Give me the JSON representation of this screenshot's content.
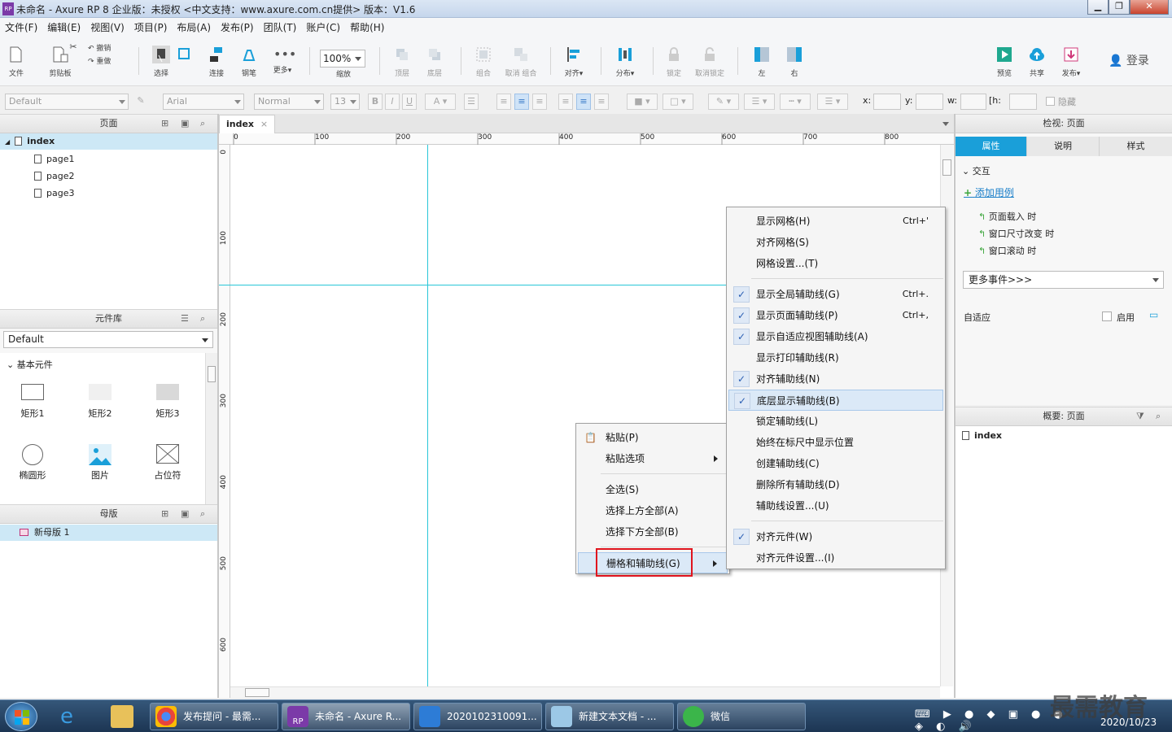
{
  "window": {
    "title": "未命名 - Axure RP 8 企业版：未授权      <中文支持：www.axure.com.cn提供> 版本：V1.6",
    "logo": "RP",
    "controls": [
      "minimize",
      "maximize",
      "close"
    ]
  },
  "menubar": [
    "文件(F)",
    "编辑(E)",
    "视图(V)",
    "项目(P)",
    "布局(A)",
    "发布(P)",
    "团队(T)",
    "账户(C)",
    "帮助(H)"
  ],
  "toolbar": {
    "file": "文件",
    "clipboard": "剪贴板",
    "cut": "",
    "undo": "撤销",
    "redo": "重做",
    "select": "选择",
    "connect": "连接",
    "pen": "钢笔",
    "more": "更多▾",
    "zoom_value": "100%",
    "zoom_label": "缩放",
    "top": "顶层",
    "bottom": "底层",
    "group": "组合",
    "ungroup": "取消 组合",
    "align": "对齐▾",
    "distribute": "分布▾",
    "lock": "锁定",
    "unlock": "取消锁定",
    "left": "左",
    "right": "右",
    "preview": "预览",
    "share": "共享",
    "publish": "发布▾",
    "login": "登录"
  },
  "formatbar": {
    "style": "Default",
    "font": "Arial",
    "weight": "Normal",
    "size": "13",
    "x_label": "x:",
    "y_label": "y:",
    "w_label": "w:",
    "h_label": "h:",
    "hide_label": "隐藏"
  },
  "pages_panel": {
    "title": "页面",
    "root": "index",
    "children": [
      "page1",
      "page2",
      "page3"
    ]
  },
  "library_panel": {
    "title": "元件库",
    "selected_library": "Default",
    "group": "基本元件",
    "widgets": [
      "矩形1",
      "矩形2",
      "矩形3",
      "椭圆形",
      "图片",
      "占位符"
    ]
  },
  "masters_panel": {
    "title": "母版",
    "items": [
      "新母版 1"
    ]
  },
  "canvas": {
    "tab": "index",
    "tab_close": "×",
    "ruler_h": [
      "0",
      "100",
      "200",
      "300",
      "400",
      "500",
      "600",
      "700",
      "800"
    ],
    "ruler_v": [
      "0",
      "100",
      "200",
      "300",
      "400",
      "500",
      "600"
    ]
  },
  "context_menu": {
    "items": [
      {
        "label": "粘贴(P)"
      },
      {
        "label": "粘贴选项",
        "submenu": true
      },
      {
        "label": "全选(S)"
      },
      {
        "label": "选择上方全部(A)"
      },
      {
        "label": "选择下方全部(B)"
      },
      {
        "label": "栅格和辅助线(G)",
        "submenu": true,
        "highlighted": true
      }
    ]
  },
  "submenu": {
    "items": [
      {
        "label": "显示网格(H)",
        "shortcut": "Ctrl+'",
        "checked": false
      },
      {
        "label": "对齐网格(S)",
        "checked": false
      },
      {
        "label": "网格设置...(T)",
        "checked": false
      },
      {
        "label": "显示全局辅助线(G)",
        "shortcut": "Ctrl+.",
        "checked": true
      },
      {
        "label": "显示页面辅助线(P)",
        "shortcut": "Ctrl+,",
        "checked": true
      },
      {
        "label": "显示自适应视图辅助线(A)",
        "checked": true
      },
      {
        "label": "显示打印辅助线(R)",
        "checked": false
      },
      {
        "label": "对齐辅助线(N)",
        "checked": true
      },
      {
        "label": "底层显示辅助线(B)",
        "checked": true,
        "hover": true
      },
      {
        "label": "锁定辅助线(L)",
        "checked": false
      },
      {
        "label": "始终在标尺中显示位置",
        "checked": false
      },
      {
        "label": "创建辅助线(C)",
        "checked": false
      },
      {
        "label": "删除所有辅助线(D)",
        "checked": false
      },
      {
        "label": "辅助线设置...(U)",
        "checked": false
      },
      {
        "label": "对齐元件(W)",
        "checked": true
      },
      {
        "label": "对齐元件设置...(I)",
        "checked": false
      }
    ]
  },
  "inspector": {
    "title": "检视: 页面",
    "tabs": [
      "属性",
      "说明",
      "样式"
    ],
    "section": "交互",
    "add_case": "添加用例",
    "events": [
      "页面载入 时",
      "窗口尺寸改变 时",
      "窗口滚动 时"
    ],
    "more_events": "更多事件>>>",
    "adaptive_label": "自适应",
    "enable_label": "启用"
  },
  "outline": {
    "title": "概要: 页面",
    "item": "index"
  },
  "taskbar": {
    "items": [
      "发布提问 - 最需...",
      "未命名 - Axure R...",
      "2020102310091...",
      "新建文本文档 - ...",
      "微信"
    ],
    "date": "2020/10/23",
    "watermark": "最需教育"
  },
  "colors": {
    "accent": "#1a9fd9",
    "guide": "#29c7d8",
    "highlight_box": "#e0141e"
  }
}
